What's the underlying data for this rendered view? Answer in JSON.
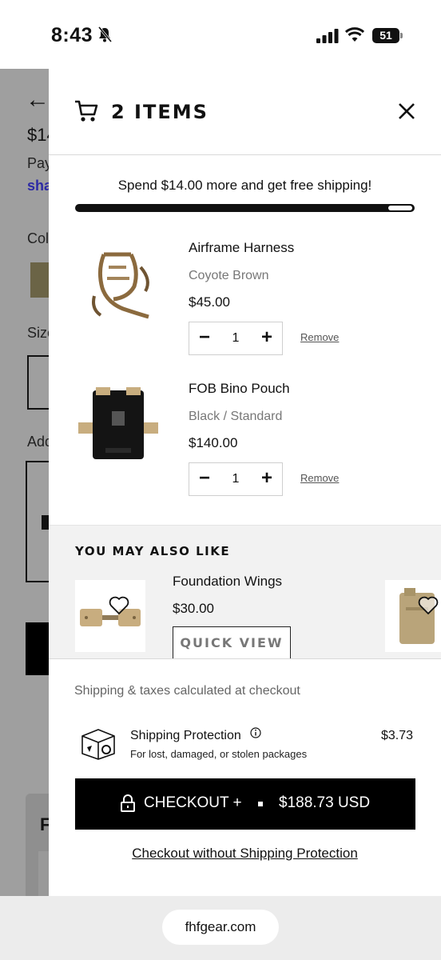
{
  "status_bar": {
    "time": "8:43",
    "battery": "51"
  },
  "background_page": {
    "back_arrow": "←",
    "price_fragment": "$14",
    "pay_fragment": "Pay",
    "shop_fragment": "sha",
    "color_label_fragment": "Col",
    "size_label_fragment": "Size",
    "add_label_fragment": "Add",
    "card_fragment": "F"
  },
  "drawer": {
    "title": "2 ITEMS",
    "shipping_message": "Spend $14.00 more and get free shipping!",
    "progress_remaining_fraction": 0.07,
    "items": [
      {
        "name": "Airframe Harness",
        "variant": "Coyote Brown",
        "price": "$45.00",
        "quantity": "1",
        "remove_label": "Remove"
      },
      {
        "name": "FOB Bino Pouch",
        "variant": "Black / Standard",
        "price": "$140.00",
        "quantity": "1",
        "remove_label": "Remove"
      }
    ],
    "recommendations": {
      "heading": "YOU MAY ALSO LIKE",
      "product": {
        "name": "Foundation Wings",
        "price": "$30.00",
        "quick_view_label": "QUICK VIEW"
      }
    },
    "footer": {
      "taxes_note": "Shipping & taxes calculated at checkout",
      "shipping_protection": {
        "title": "Shipping Protection",
        "description": "For lost, damaged, or stolen packages",
        "price": "$3.73"
      },
      "checkout_label": "CHECKOUT +",
      "checkout_total": "$188.73 USD",
      "checkout_without_label": "Checkout without Shipping Protection"
    }
  },
  "browser": {
    "url": "fhfgear.com"
  },
  "colors": {
    "accent": "#000000",
    "coyote": "#8b6a3e",
    "tan": "#c8ad7f",
    "overlay": "#9f9f9f"
  }
}
